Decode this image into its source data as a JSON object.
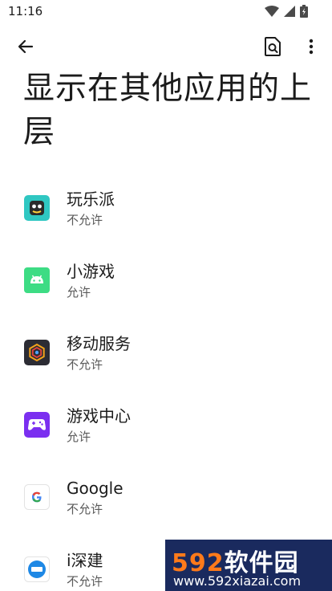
{
  "status_bar": {
    "time": "11:16"
  },
  "toolbar": {
    "back_icon": "arrow-back-icon",
    "search_icon": "search-settings-icon",
    "more_icon": "more-vert-icon"
  },
  "page": {
    "title": "显示在其他应用的上层"
  },
  "apps": [
    {
      "name": "玩乐派",
      "status": "不允许",
      "icon": "wanlepai-icon"
    },
    {
      "name": "小游戏",
      "status": "允许",
      "icon": "android-icon"
    },
    {
      "name": "移动服务",
      "status": "不允许",
      "icon": "mobile-services-icon"
    },
    {
      "name": "游戏中心",
      "status": "允许",
      "icon": "gamepad-icon"
    },
    {
      "name": "Google",
      "status": "不允许",
      "icon": "google-icon"
    },
    {
      "name": "i深建",
      "status": "不允许",
      "icon": "ishenjian-icon"
    }
  ],
  "watermark": {
    "logo_num": "592",
    "logo_text": "软件园",
    "url": "www.592xiazai.com"
  }
}
